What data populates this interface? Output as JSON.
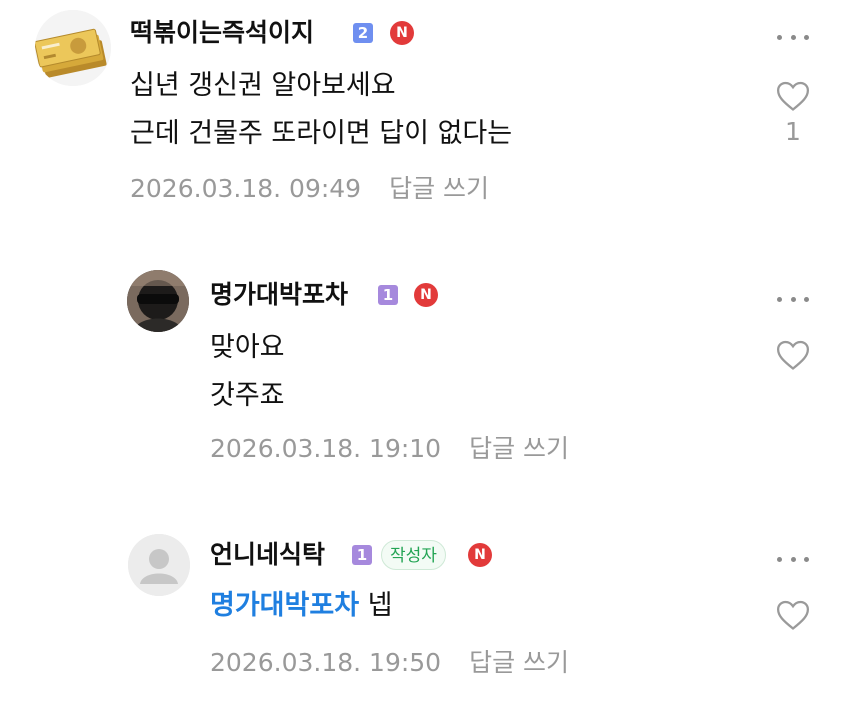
{
  "comments": [
    {
      "nickname": "떡볶이는즉석이지",
      "level": "2",
      "new_badge": "N",
      "lines": [
        "십년 갱신권 알아보세요",
        "근데 건물주 또라이면 답이 없다는"
      ],
      "timestamp": "2026.03.18. 09:49",
      "reply_label": "답글 쓰기",
      "like_count": "1",
      "avatar_icon": "money-bill-icon"
    },
    {
      "nickname": "명가대박포차",
      "level": "1",
      "new_badge": "N",
      "lines": [
        "맞아요",
        "갓주죠"
      ],
      "timestamp": "2026.03.18. 19:10",
      "reply_label": "답글 쓰기",
      "avatar_icon": "profile-photo-icon"
    },
    {
      "nickname": "언니네식탁",
      "level": "1",
      "author_tag": "작성자",
      "new_badge": "N",
      "mention": "명가대박포차",
      "text": "넵",
      "timestamp": "2026.03.18. 19:50",
      "reply_label": "답글 쓰기",
      "avatar_icon": "default-user-icon"
    }
  ],
  "colors": {
    "mention": "#1f7fe0",
    "meta_gray": "#999999",
    "new_badge": "#e23a3a",
    "level2": "#6f8ff0",
    "level1": "#a689dd",
    "author_tag": "#23a454"
  }
}
